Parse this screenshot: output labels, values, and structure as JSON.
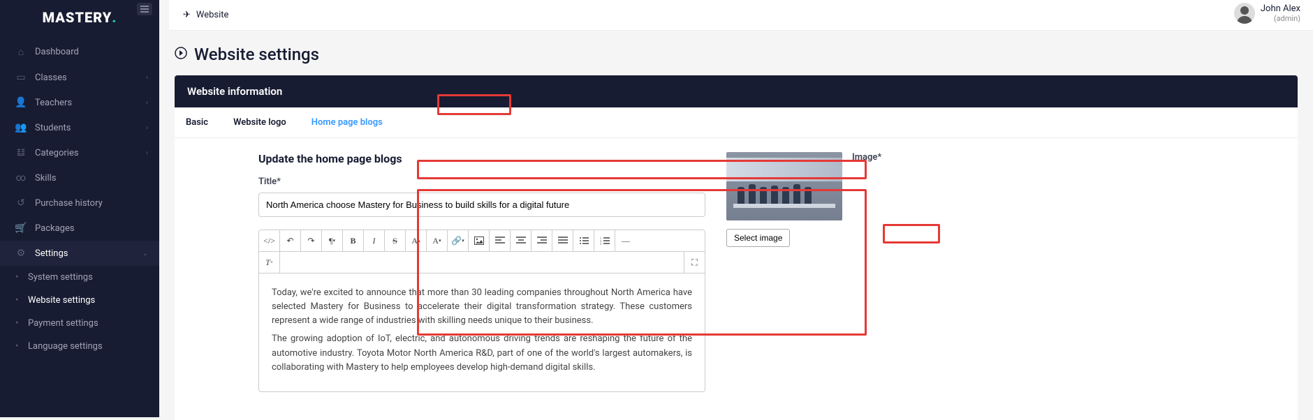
{
  "brand": {
    "name": "MASTERY",
    "dot": "."
  },
  "topbar": {
    "breadcrumb": "Website"
  },
  "user": {
    "name": "John Alex",
    "role": "(admin)"
  },
  "page": {
    "title": "Website settings"
  },
  "card": {
    "header": "Website information"
  },
  "tabs": [
    {
      "label": "Basic",
      "active": false
    },
    {
      "label": "Website logo",
      "active": false
    },
    {
      "label": "Home page blogs",
      "active": true
    }
  ],
  "form": {
    "heading": "Update the home page blogs",
    "title_label": "Title*",
    "title_value": "North America choose Mastery for Business to build skills for a digital future",
    "image_label": "Image*",
    "select_image": "Select image",
    "body_p1": "Today, we're excited to announce that more than 30 leading companies throughout North America have selected Mastery for Business to accelerate their digital transformation strategy. These customers represent a wide range of industries with skilling needs unique to their business.",
    "body_p2": " The growing adoption of IoT, electric, and autonomous driving trends are reshaping the future of the automotive industry. Toyota Motor North America R&D, part of one of the world's largest automakers, is collaborating with Mastery to help employees develop high-demand digital skills."
  },
  "sidebar": {
    "items": [
      {
        "label": "Dashboard",
        "icon": "home"
      },
      {
        "label": "Classes",
        "icon": "board",
        "chev": true
      },
      {
        "label": "Teachers",
        "icon": "user",
        "chev": true
      },
      {
        "label": "Students",
        "icon": "users",
        "chev": true
      },
      {
        "label": "Categories",
        "icon": "branch",
        "chev": true
      },
      {
        "label": "Skills",
        "icon": "cloud"
      },
      {
        "label": "Purchase history",
        "icon": "history"
      },
      {
        "label": "Packages",
        "icon": "cart"
      },
      {
        "label": "Settings",
        "icon": "gear",
        "active": true,
        "chev": true,
        "open": true
      }
    ],
    "settings_sub": [
      {
        "label": "System settings"
      },
      {
        "label": "Website settings",
        "active": true
      },
      {
        "label": "Payment settings"
      },
      {
        "label": "Language settings"
      }
    ]
  },
  "editor_tools_row1": [
    "code",
    "undo",
    "redo",
    "para",
    "bold",
    "italic",
    "strike",
    "Aup",
    "Adown",
    "link",
    "image",
    "align-left",
    "align-center",
    "align-right",
    "align-justify",
    "list-ul",
    "list-ol",
    "hr"
  ],
  "editor_tools_row2": [
    "clear",
    "fullscreen"
  ]
}
